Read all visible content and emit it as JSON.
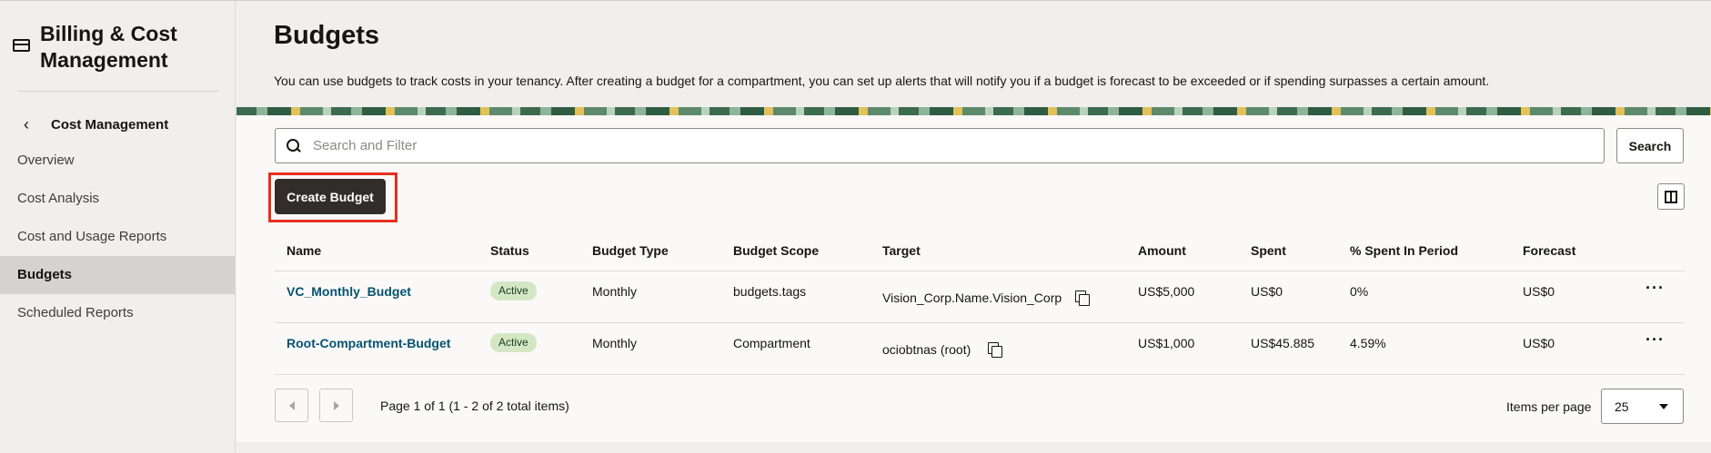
{
  "sidebar": {
    "app_title": "Billing & Cost Management",
    "back_label": "Cost Management",
    "items": [
      {
        "label": "Overview",
        "active": false
      },
      {
        "label": "Cost Analysis",
        "active": false
      },
      {
        "label": "Cost and Usage Reports",
        "active": false
      },
      {
        "label": "Budgets",
        "active": true
      },
      {
        "label": "Scheduled Reports",
        "active": false
      }
    ]
  },
  "main": {
    "title": "Budgets",
    "description": "You can use budgets to track costs in your tenancy. After creating a budget for a compartment, you can set up alerts that will notify you if a budget is forecast to be exceeded or if spending surpasses a certain amount.",
    "search": {
      "placeholder": "Search and Filter",
      "value": "",
      "button_label": "Search"
    },
    "create_button_label": "Create Budget",
    "table": {
      "columns": [
        "Name",
        "Status",
        "Budget Type",
        "Budget Scope",
        "Target",
        "Amount",
        "Spent",
        "% Spent In Period",
        "Forecast"
      ],
      "rows": [
        {
          "name": "VC_Monthly_Budget",
          "status": "Active",
          "type": "Monthly",
          "scope": "budgets.tags",
          "target": "Vision_Corp.Name.Vision_Corp",
          "amount": "US$5,000",
          "spent": "US$0",
          "pct": "0%",
          "forecast": "US$0"
        },
        {
          "name": "Root-Compartment-Budget",
          "status": "Active",
          "type": "Monthly",
          "scope": "Compartment",
          "target": "ociobtnas (root)",
          "amount": "US$1,000",
          "spent": "US$45.885",
          "pct": "4.59%",
          "forecast": "US$0"
        }
      ]
    },
    "pagination": {
      "info": "Page 1 of 1 (1 - 2 of 2 total items)",
      "items_per_page_label": "Items per page",
      "items_per_page_value": "25"
    }
  },
  "icons": {
    "app": "credit-card-icon",
    "back": "chevron-left-icon",
    "search": "search-icon",
    "columns": "columns-icon",
    "copy": "copy-icon",
    "more": "more-icon",
    "prev": "triangle-left-icon",
    "next": "triangle-right-icon",
    "select": "caret-down-icon"
  },
  "colors": {
    "accent_link": "#04536f",
    "primary_button": "#312d2a",
    "highlight": "#e5301d",
    "badge_bg": "#d4e7c5"
  }
}
